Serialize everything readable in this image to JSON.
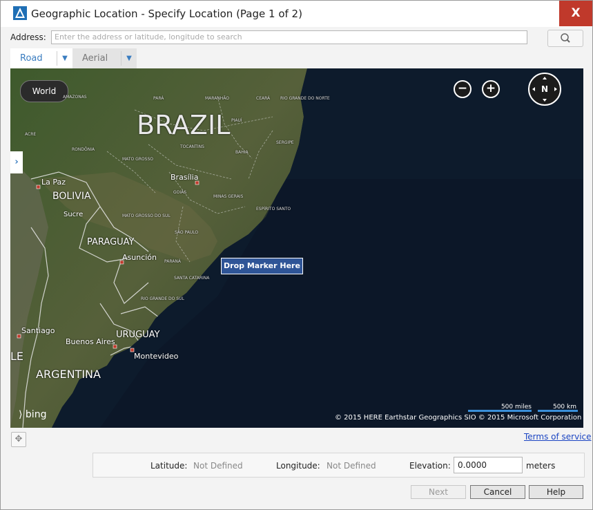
{
  "window": {
    "title": "Geographic Location - Specify Location (Page 1 of 2)",
    "close_label": "X"
  },
  "address": {
    "label": "Address:",
    "placeholder": "Enter the address or latitude, longitude to search"
  },
  "tabs": [
    {
      "label": "Road"
    },
    {
      "label": "Aerial"
    }
  ],
  "map": {
    "world_label": "World",
    "drop_marker_label": "Drop Marker Here",
    "compass_label": "N",
    "bing_label": "bing",
    "scale_miles": "500 miles",
    "scale_km": "500 km",
    "copyright": "© 2015 HERE    Earthstar Geographics SIO   © 2015 Microsoft Corporation",
    "labels": {
      "brazil": "BRAZIL",
      "bolivia": "BOLIVIA",
      "paraguay": "PARAGUAY",
      "uruguay": "URUGUAY",
      "argentina": "ARGENTINA",
      "la_paz": "La Paz",
      "sucre": "Sucre",
      "brasilia": "Brasília",
      "asuncion": "Asunción",
      "santiago": "Santiago",
      "buenos_aires": "Buenos Aires",
      "montevideo": "Montevideo",
      "chile_partial": "LE",
      "amazonas": "AMAZONAS",
      "para": "PARÁ",
      "maranhao": "MARANHÃO",
      "ceara": "CEARÁ",
      "rio_grande_do_norte": "RIO GRANDE DO NORTE",
      "piaui": "PIAUÍ",
      "acre": "ACRE",
      "tocantins": "TOCANTINS",
      "sergipe": "SERGIPE",
      "bahia": "BAHIA",
      "rondonia": "RONDÔNIA",
      "mato_grosso": "MATO GROSSO",
      "goias": "GOIÁS",
      "minas_gerais": "MINAS GERAIS",
      "espirito_santo": "ESPÍRITO SANTO",
      "mato_grosso_do_sul": "MATO GROSSO DO SUL",
      "sao_paulo": "SÃO PAULO",
      "parana": "PARANÁ",
      "santa_catarina": "SANTA CATARINA",
      "rio_grande_do_sul": "RIO GRANDE DO SUL"
    }
  },
  "terms_label": "Terms of service",
  "coords": {
    "latitude_label": "Latitude:",
    "latitude_value": "Not Defined",
    "longitude_label": "Longitude:",
    "longitude_value": "Not Defined",
    "elevation_label": "Elevation:",
    "elevation_value": "0.0000",
    "elevation_unit": "meters"
  },
  "buttons": {
    "next": "Next",
    "cancel": "Cancel",
    "help": "Help"
  }
}
